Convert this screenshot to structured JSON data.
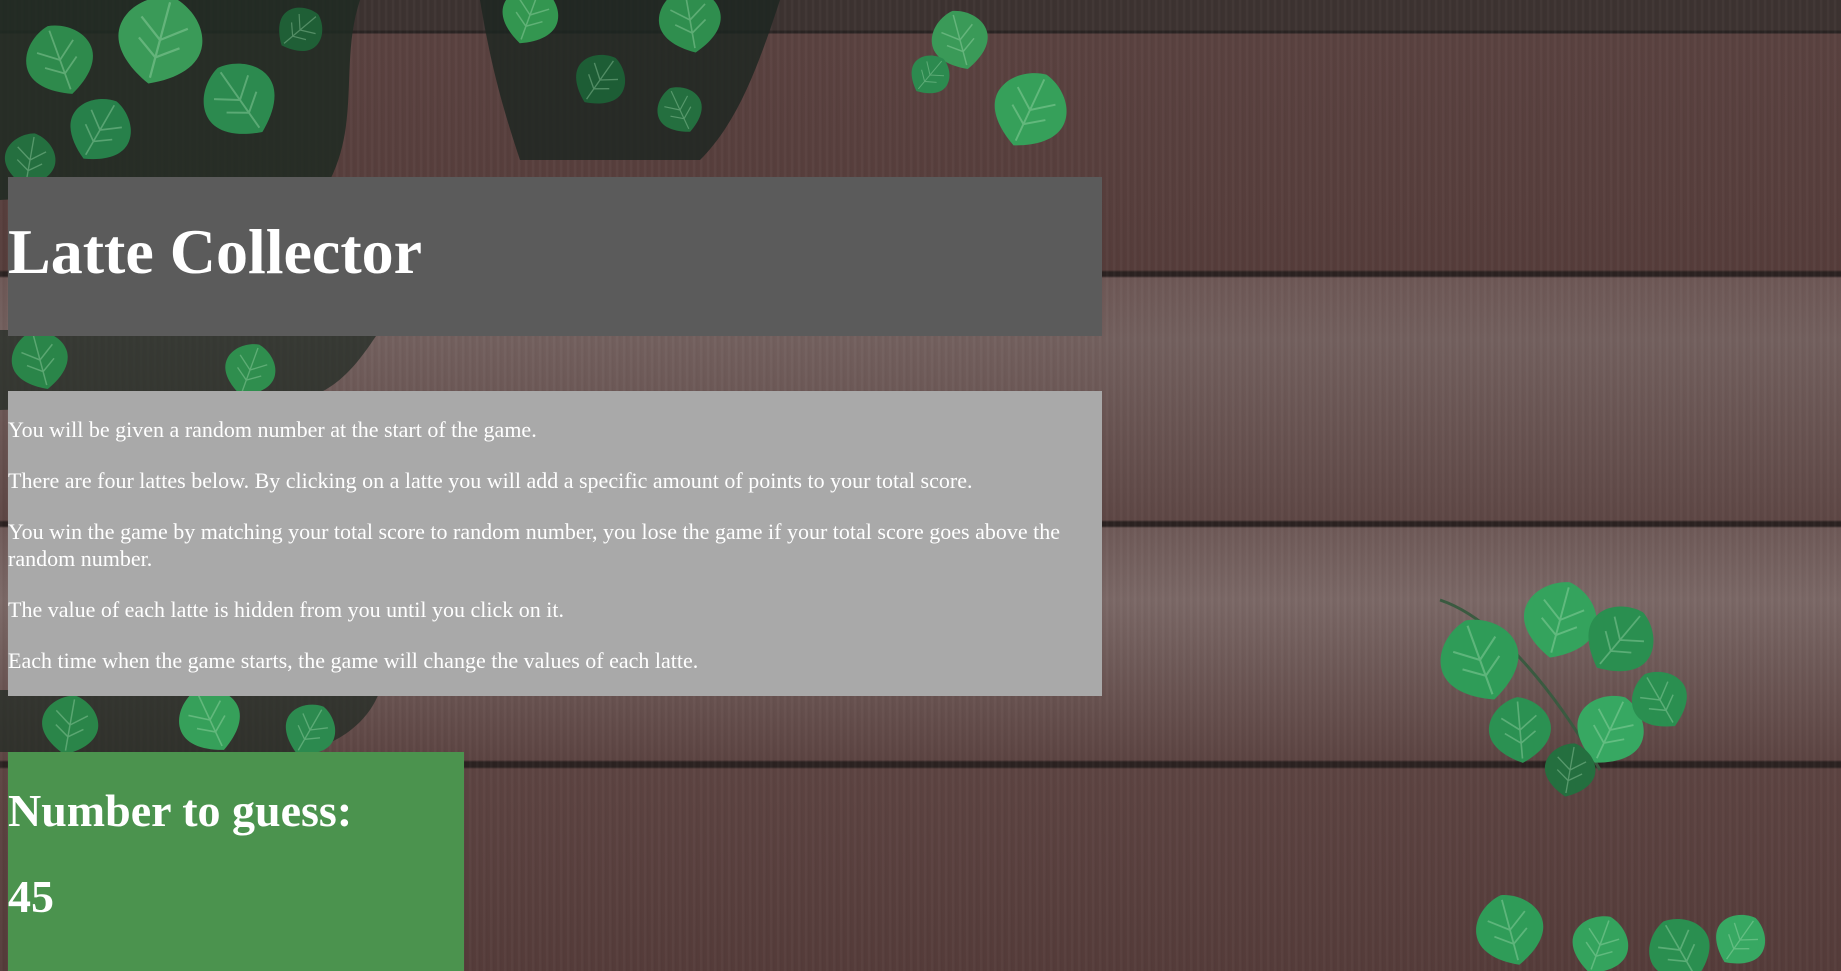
{
  "game": {
    "title": "Latte Collector"
  },
  "rules": [
    "You will be given a random number at the start of the game.",
    "There are four lattes below. By clicking on a latte you will add a specific amount of points to your total score.",
    "You win the game by matching your total score to random number, you lose the game if your total score goes above the random number.",
    "The value of each latte is hidden from you until you click on it.",
    "Each time when the game starts, the game will change the values of each latte."
  ],
  "target": {
    "label": "Number to guess:",
    "value": "45"
  },
  "colors": {
    "title_panel": "#5b5b5b",
    "rules_panel": "#a9a9a9",
    "target_panel": "#4b934e",
    "text": "#ffffff"
  },
  "icons": {
    "background": "ivy-leaves-on-wood-planks"
  }
}
